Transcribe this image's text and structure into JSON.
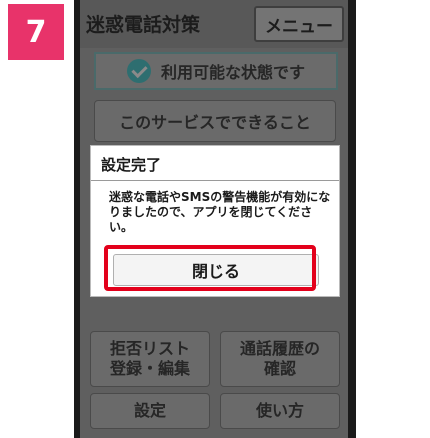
{
  "step": {
    "number": "7"
  },
  "app": {
    "title": "迷惑電話対策",
    "menu_label": "メニュー"
  },
  "status": {
    "label": "利用可能な状態です"
  },
  "service_button": {
    "label": "このサービスでできること"
  },
  "dialog": {
    "title": "設定完了",
    "message": "迷惑な電話やSMSの警告機能が有効になりましたので、アプリを閉じてください。",
    "close_label": "閉じる"
  },
  "grid": {
    "reject_label_1": "拒否リスト",
    "reject_label_2": "登録・編集",
    "history_label_1": "通話履歴の",
    "history_label_2": "確認",
    "settings_label": "設定",
    "howto_label": "使い方"
  },
  "colors": {
    "badge": "#e8336a",
    "highlight": "#e3001b",
    "status_check": "#2e6e70"
  }
}
